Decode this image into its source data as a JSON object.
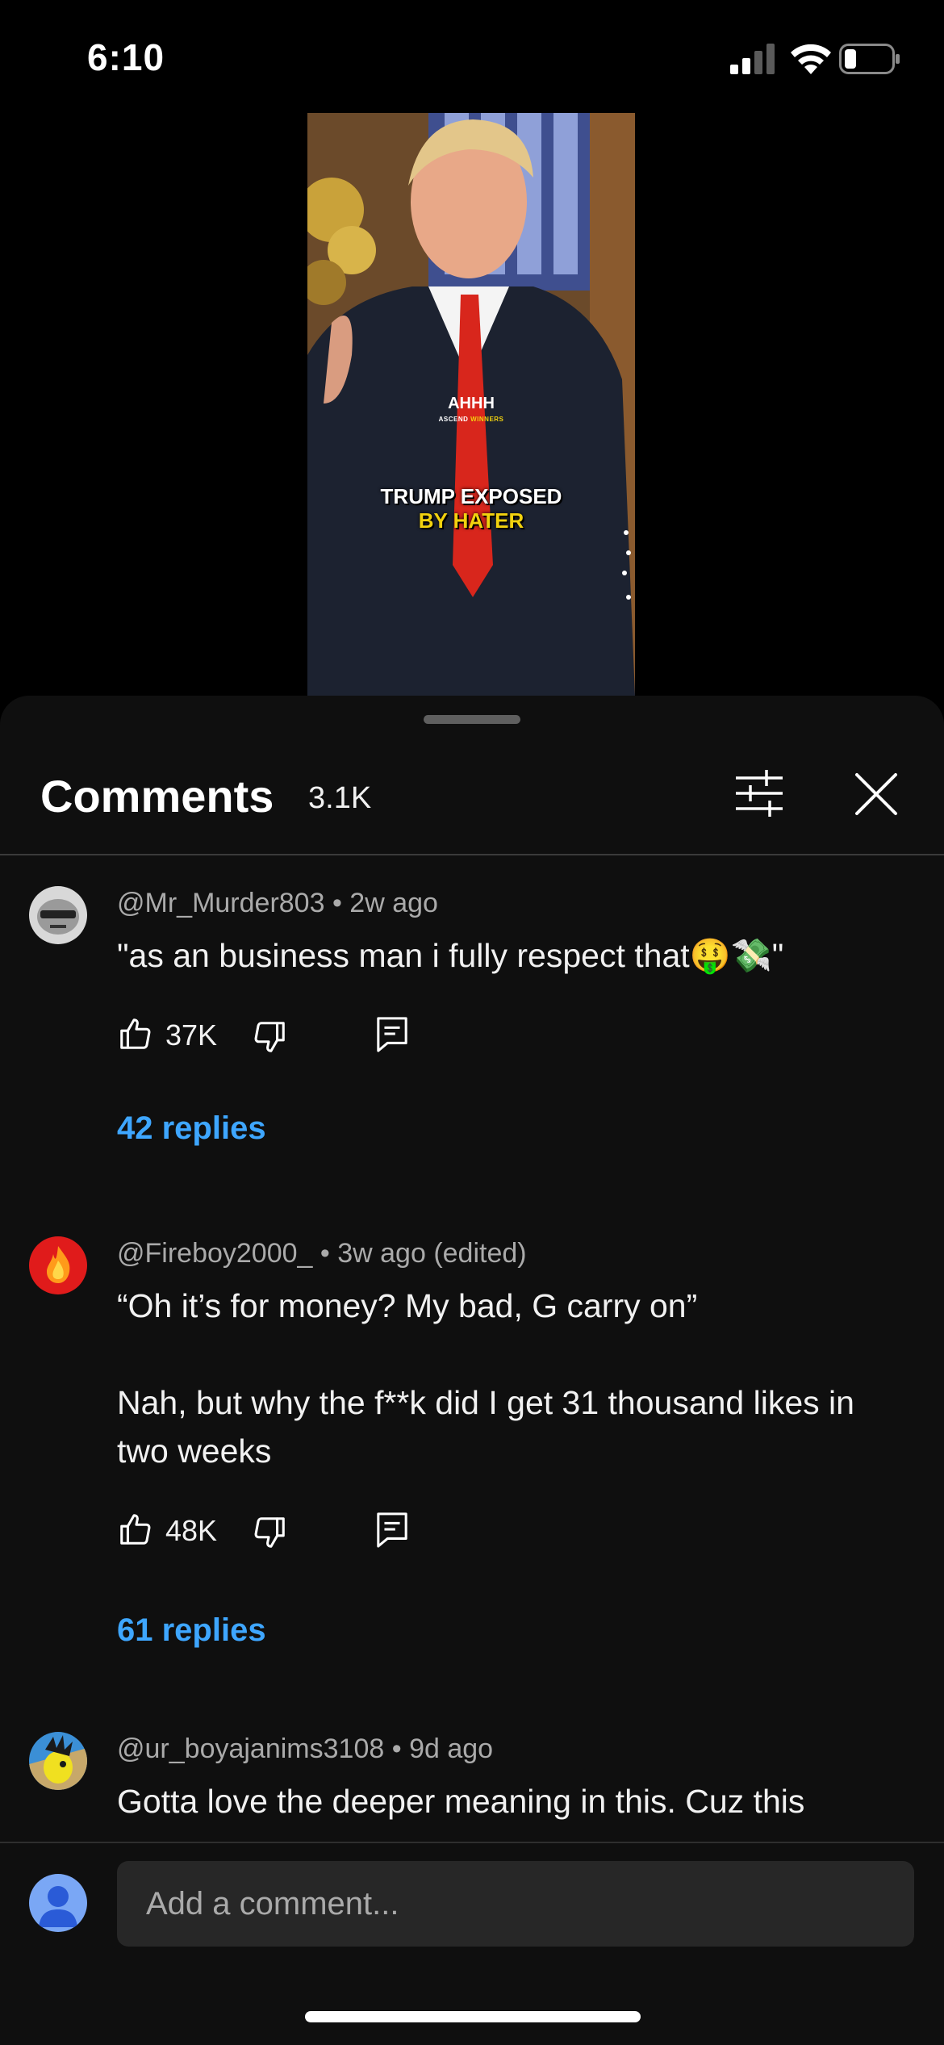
{
  "status_bar": {
    "time": "6:10"
  },
  "video": {
    "caption_small": "AHHH",
    "caption_small_sub_left": "ASCEND",
    "caption_small_sub_right": "WINNERS",
    "caption_line1": "TRUMP EXPOSED",
    "caption_line2": "BY HATER"
  },
  "sheet": {
    "title": "Comments",
    "count": "3.1K"
  },
  "comments": [
    {
      "author": "@Mr_Murder803",
      "age": "2w ago",
      "text": "\"as an business man i fully respect that🤑💸\"",
      "likes": "37K",
      "replies": "42 replies"
    },
    {
      "author": "@Fireboy2000_",
      "age": "3w ago (edited)",
      "text_line1": "“Oh it’s for money? My bad, G carry on”",
      "text_line2": "Nah, but why the f**k did I get 31 thousand likes in two weeks",
      "likes": "48K",
      "replies": "61 replies"
    },
    {
      "author": "@ur_boyajanims3108",
      "age": "9d ago",
      "text": "Gotta love the deeper meaning in this. Cuz this"
    }
  ],
  "add_comment": {
    "placeholder": "Add a comment..."
  },
  "colors": {
    "accent": "#3ea6ff",
    "sheet_bg": "#0f0f0f",
    "caption_yellow": "#f2d20e"
  }
}
